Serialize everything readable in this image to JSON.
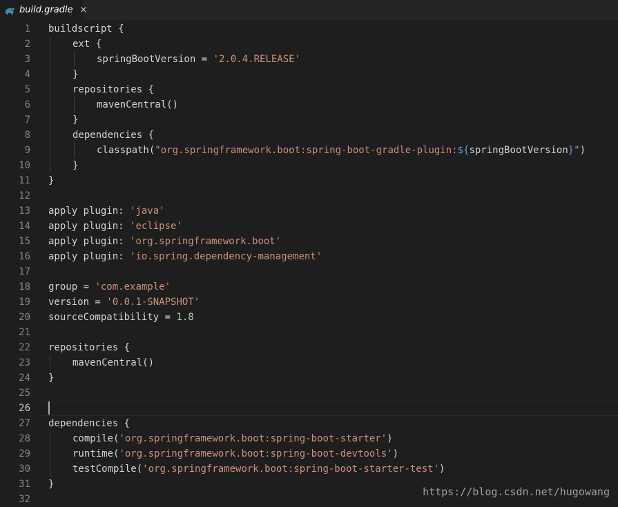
{
  "tab": {
    "filename": "build.gradle",
    "close_glyph": "×",
    "icon": "gradle-elephant-icon"
  },
  "colors": {
    "background": "#1e1e1e",
    "string": "#ce9178",
    "number": "#b5cea8",
    "interp": "#569cd6"
  },
  "line_numbers": [
    "1",
    "2",
    "3",
    "4",
    "5",
    "6",
    "7",
    "8",
    "9",
    "10",
    "11",
    "12",
    "13",
    "14",
    "15",
    "16",
    "17",
    "18",
    "19",
    "20",
    "21",
    "22",
    "23",
    "24",
    "25",
    "26",
    "27",
    "28",
    "29",
    "30",
    "31",
    "32"
  ],
  "active_line": "26",
  "code": {
    "l1": "buildscript {",
    "l2": "ext {",
    "l3a": "springBootVersion = ",
    "l3b": "'2.0.4.RELEASE'",
    "l4": "}",
    "l5": "repositories {",
    "l6": "mavenCentral()",
    "l7": "}",
    "l8": "dependencies {",
    "l9a": "classpath(",
    "l9b": "\"org.springframework.boot:spring-boot-gradle-plugin:",
    "l9c": "${",
    "l9d": "springBootVersion",
    "l9e": "}",
    "l9f": "\"",
    "l9g": ")",
    "l10": "}",
    "l11": "}",
    "l13a": "apply plugin: ",
    "l13b": "'java'",
    "l14a": "apply plugin: ",
    "l14b": "'eclipse'",
    "l15a": "apply plugin: ",
    "l15b": "'org.springframework.boot'",
    "l16a": "apply plugin: ",
    "l16b": "'io.spring.dependency-management'",
    "l18a": "group = ",
    "l18b": "'com.example'",
    "l19a": "version = ",
    "l19b": "'0.0.1-SNAPSHOT'",
    "l20a": "sourceCompatibility = ",
    "l20b": "1.8",
    "l22": "repositories {",
    "l23": "mavenCentral()",
    "l24": "}",
    "l27": "dependencies {",
    "l28a": "compile(",
    "l28b": "'org.springframework.boot:spring-boot-starter'",
    "l28c": ")",
    "l29a": "runtime(",
    "l29b": "'org.springframework.boot:spring-boot-devtools'",
    "l29c": ")",
    "l30a": "testCompile(",
    "l30b": "'org.springframework.boot:spring-boot-starter-test'",
    "l30c": ")",
    "l31": "}"
  },
  "watermark": "https://blog.csdn.net/hugowang"
}
